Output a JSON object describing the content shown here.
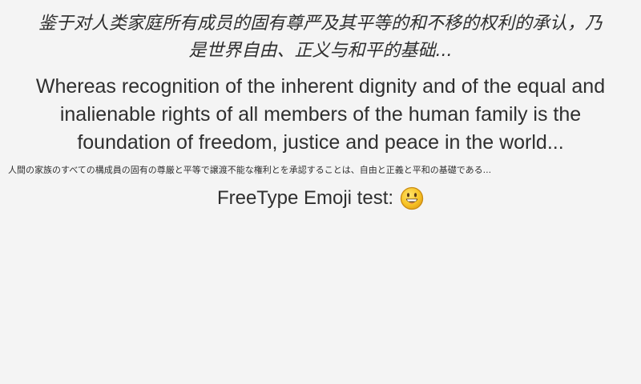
{
  "chinese": {
    "line1": "鉴于对人类家庭所有成员的固有尊严及其平等的和不移的权利的承认，乃",
    "line2": "是世界自由、正义与和平的基础..."
  },
  "english": {
    "line1": "Whereas recognition of the inherent dignity and of the equal and",
    "line2": "inalienable rights of all members of the human family is the",
    "line3": "foundation of freedom, justice and peace in the world..."
  },
  "japanese": {
    "line1": "人間の家族のすべての構成員の固有の尊厳と平等で譲渡不能な権利とを承認することは、自由と正義と平和の基礎である..."
  },
  "emoji_test": {
    "label": "FreeType Emoji test:",
    "icon": "grinning-face-emoji",
    "face_color": "#f7c325",
    "outline_color": "#c98a12"
  }
}
